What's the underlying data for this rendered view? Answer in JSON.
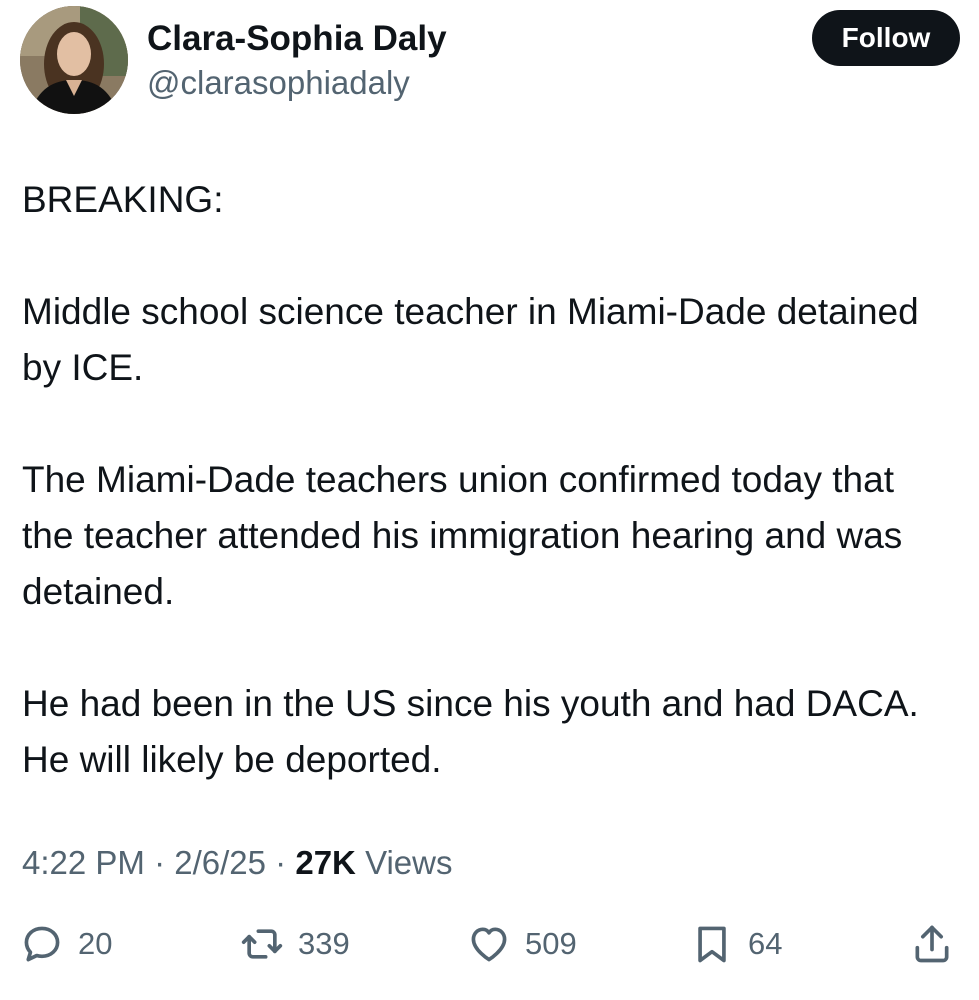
{
  "author": {
    "display_name": "Clara-Sophia Daly",
    "handle": "@clarasophiadaly",
    "avatar_icon": "profile-photo"
  },
  "follow_label": "Follow",
  "tweet": {
    "paragraphs": [
      "BREAKING:",
      "Middle school science teacher in Miami-Dade detained by ICE.",
      "The Miami-Dade teachers union confirmed today that the teacher attended his immigration hearing and was detained.",
      "He had been in the US since his youth and had DACA. He will likely be deported."
    ]
  },
  "meta": {
    "time": "4:22 PM",
    "separator": "·",
    "date": "2/6/25",
    "views_count": "27K",
    "views_label": "Views"
  },
  "actions": {
    "reply": {
      "icon": "reply-icon",
      "count": "20"
    },
    "repost": {
      "icon": "repost-icon",
      "count": "339"
    },
    "like": {
      "icon": "heart-icon",
      "count": "509"
    },
    "bookmark": {
      "icon": "bookmark-icon",
      "count": "64"
    },
    "share": {
      "icon": "share-icon"
    }
  },
  "colors": {
    "text_primary": "#0f1419",
    "text_secondary": "#536471",
    "follow_bg": "#0f1419",
    "follow_text": "#ffffff"
  }
}
